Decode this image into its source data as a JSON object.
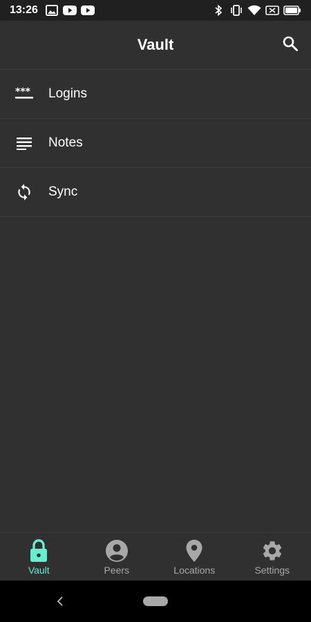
{
  "status_bar": {
    "time": "13:26",
    "left_icons": [
      "image-icon",
      "youtube-icon",
      "youtube-icon"
    ],
    "right_icons": [
      "bluetooth-icon",
      "vibrate-icon",
      "wifi-icon",
      "sim-off-icon",
      "battery-icon"
    ]
  },
  "app_bar": {
    "title": "Vault",
    "search_icon": "search-icon"
  },
  "menu": [
    {
      "label": "Logins",
      "icon": "password-dots-icon"
    },
    {
      "label": "Notes",
      "icon": "notes-icon"
    },
    {
      "label": "Sync",
      "icon": "sync-icon"
    }
  ],
  "bottom_nav": {
    "items": [
      {
        "label": "Vault",
        "icon": "lock-icon",
        "active": true
      },
      {
        "label": "Peers",
        "icon": "account-circle-icon",
        "active": false
      },
      {
        "label": "Locations",
        "icon": "location-pin-icon",
        "active": false
      },
      {
        "label": "Settings",
        "icon": "gear-icon",
        "active": false
      }
    ],
    "active_color": "#64f0d0",
    "inactive_color": "#a8a8a8"
  },
  "colors": {
    "background": "#303030",
    "status_bar": "#202020",
    "system_nav": "#000000"
  }
}
